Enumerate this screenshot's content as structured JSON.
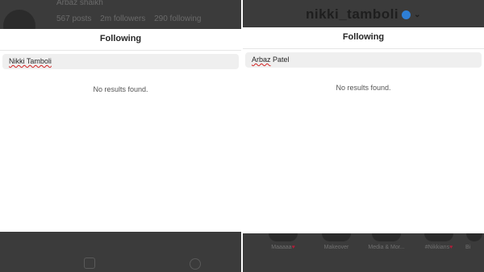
{
  "left": {
    "background_profile": {
      "username": "Arbaz shaikh",
      "stats": [
        "567 posts",
        "2m followers",
        "290 following"
      ]
    },
    "modal": {
      "title": "Following",
      "search_value": "Nikki Tamboli",
      "empty_message": "No results found."
    }
  },
  "right": {
    "background_profile": {
      "title": "nikki_tamboli"
    },
    "modal": {
      "title": "Following",
      "search_value": "Arbaz Patel",
      "empty_message": "No results found."
    },
    "stories": [
      {
        "label": "Maaaaa",
        "heart": true
      },
      {
        "label": "Makeover",
        "heart": false
      },
      {
        "label": "Media & Mor...",
        "heart": false
      },
      {
        "label": "#Nikkians",
        "heart": true
      },
      {
        "label": "Bi",
        "heart": false
      }
    ]
  },
  "icons": [
    "camera-icon",
    "compass-icon",
    "verified-badge-icon",
    "chevron-down-icon",
    "heart-icon"
  ],
  "colors": {
    "overlay": "#3b3b3b",
    "modal_bg": "#ffffff",
    "search_bg": "#efefef",
    "spellcheck_underline": "#d12222",
    "verified": "#2e7fd6"
  }
}
